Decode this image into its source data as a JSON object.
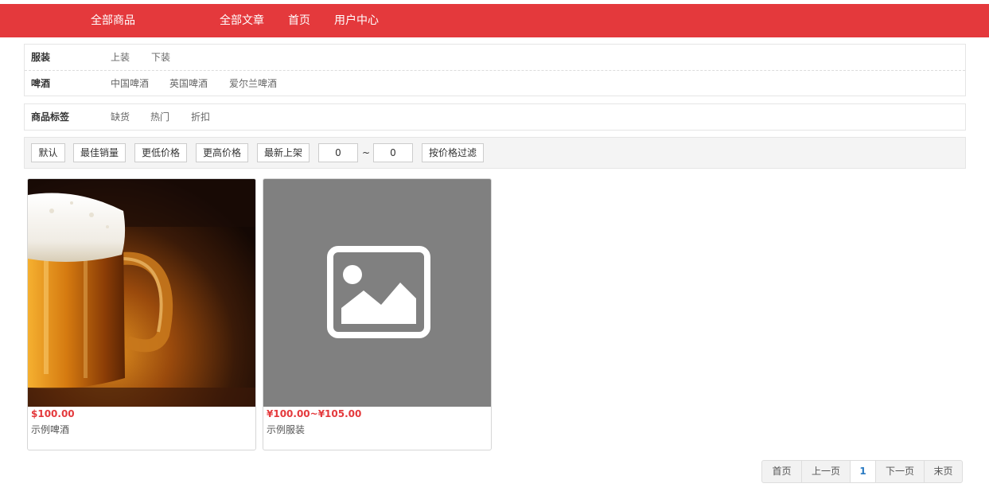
{
  "nav": {
    "all_goods": "全部商品",
    "all_articles": "全部文章",
    "home": "首页",
    "user_center": "用户中心"
  },
  "category_filters": [
    {
      "name": "服装",
      "options": [
        "上装",
        "下装"
      ]
    },
    {
      "name": "啤酒",
      "options": [
        "中国啤酒",
        "英国啤酒",
        "爱尔兰啤酒"
      ]
    }
  ],
  "tag_filter": {
    "name": "商品标签",
    "options": [
      "缺货",
      "热门",
      "折扣"
    ]
  },
  "sort": {
    "default": "默认",
    "best_sales": "最佳销量",
    "lower_price": "更低价格",
    "higher_price": "更高价格",
    "newest": "最新上架",
    "price_min": "0",
    "tilde": "~",
    "price_max": "0",
    "filter_button": "按价格过滤"
  },
  "products": [
    {
      "price": "$100.00",
      "name": "示例啤酒",
      "image": "beer-mug-photo"
    },
    {
      "price": "¥100.00~¥105.00",
      "name": "示例服装",
      "image": "image-placeholder-icon"
    }
  ],
  "pagination": {
    "first": "首页",
    "prev": "上一页",
    "current": "1",
    "next": "下一页",
    "last": "末页"
  },
  "colors": {
    "nav_bg": "#e4393c",
    "price": "#e4393c",
    "pager_active": "#2a7ac2",
    "placeholder_bg": "#808080"
  }
}
